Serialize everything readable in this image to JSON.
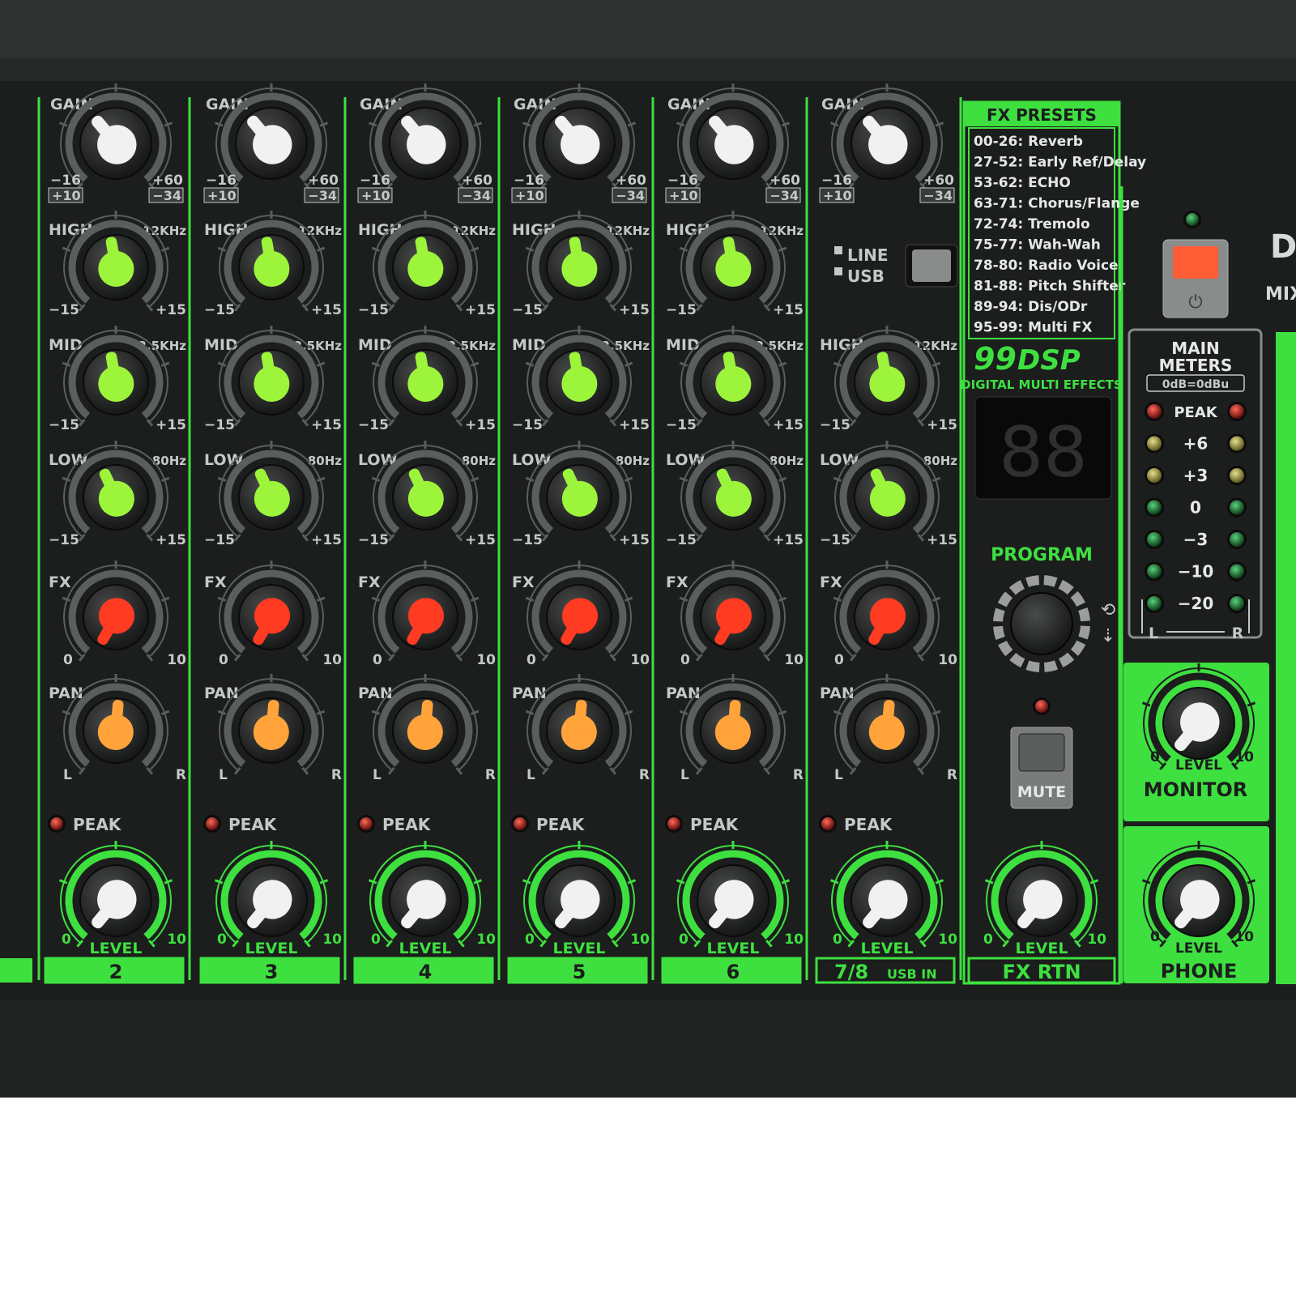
{
  "channels": [
    {
      "number": "2",
      "usb_sub": ""
    },
    {
      "number": "3",
      "usb_sub": ""
    },
    {
      "number": "4",
      "usb_sub": ""
    },
    {
      "number": "5",
      "usb_sub": ""
    },
    {
      "number": "6",
      "usb_sub": ""
    },
    {
      "number": "7/8",
      "usb_sub": "USB IN"
    }
  ],
  "strip_labels": {
    "gain": "GAIN",
    "gain_min": "−16",
    "gain_max": "+60",
    "gain_alt_min": "+10",
    "gain_alt_max": "−34",
    "high": "HIGH",
    "high_freq": "12KHz",
    "mid": "MID",
    "mid_freq": "2.5KHz",
    "low": "LOW",
    "low_freq": "80Hz",
    "eq_min": "−15",
    "eq_max": "+15",
    "fx": "FX",
    "fx_min": "0",
    "fx_max": "10",
    "pan": "PAN",
    "pan_left": "L",
    "pan_right": "R",
    "peak": "PEAK",
    "level": "LEVEL",
    "level_min": "0",
    "level_max": "10"
  },
  "line_usb": {
    "line": "LINE",
    "usb": "USB"
  },
  "fx_presets": {
    "title": "FX PRESETS",
    "items": [
      "00-26: Reverb",
      "27-52: Early Ref/Delay",
      "53-62: ECHO",
      "63-71: Chorus/Flange",
      "72-74: Tremolo",
      "75-77: Wah-Wah",
      "78-80: Radio Voice",
      "81-88: Pitch Shifter",
      "89-94: Dis/ODr",
      "95-99: Multi FX"
    ]
  },
  "dsp_logo": {
    "number": "99",
    "word": "DSP",
    "subtitle": "DIGITAL MULTI EFFECTS"
  },
  "display": {
    "value": "88"
  },
  "program_label": "PROGRAM",
  "mute_label": "MUTE",
  "fx_rtn_label": "FX RTN",
  "meters": {
    "title_line1": "MAIN",
    "title_line2": "METERS",
    "reference": "0dB=0dBu",
    "rows": [
      "PEAK",
      "+6",
      "+3",
      "0",
      "−3",
      "−10",
      "−20"
    ],
    "left": "L",
    "right": "R"
  },
  "monitor": {
    "label": "MONITOR",
    "level": "LEVEL",
    "min": "0",
    "max": "10"
  },
  "phone": {
    "label": "PHONE",
    "level": "LEVEL",
    "min": "0",
    "max": "10"
  },
  "edge_text": {
    "top": "D",
    "sub": "MIX"
  },
  "colors": {
    "panel": "#1c1d1d",
    "accent_green": "#3ee040",
    "knob_white": "#f1f1f1",
    "knob_green": "#9cf53a",
    "knob_red": "#ff3b22",
    "knob_orange": "#ffa33a",
    "text_grey": "#c5c8c8"
  }
}
